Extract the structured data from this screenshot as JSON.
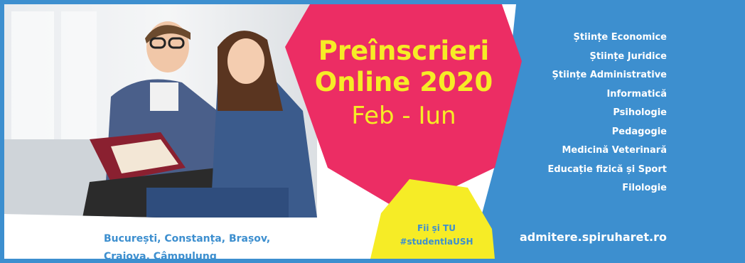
{
  "banner": {
    "headline_line1": "Preînscrieri",
    "headline_line2": "Online 2020",
    "headline_line3": "Feb - Iun",
    "cities_line1": "București, Constanța, Brașov,",
    "cities_line2": "Craiova, Câmpulung",
    "cta_line1": "Fii și TU",
    "cta_line2": "#studentlaUSH",
    "website": "admitere.spiruharet.ro",
    "faculties": [
      "Științe Economice",
      "Științe Juridice",
      "Științe Administrative",
      "Informatică",
      "Psihologie",
      "Pedagogie",
      "Medicină Veterinară",
      "Educație fizică și Sport",
      "Filologie"
    ]
  },
  "colors": {
    "blue": "#3d8fcf",
    "pink": "#ec2d64",
    "yellow": "#f6ec26",
    "white": "#ffffff"
  }
}
